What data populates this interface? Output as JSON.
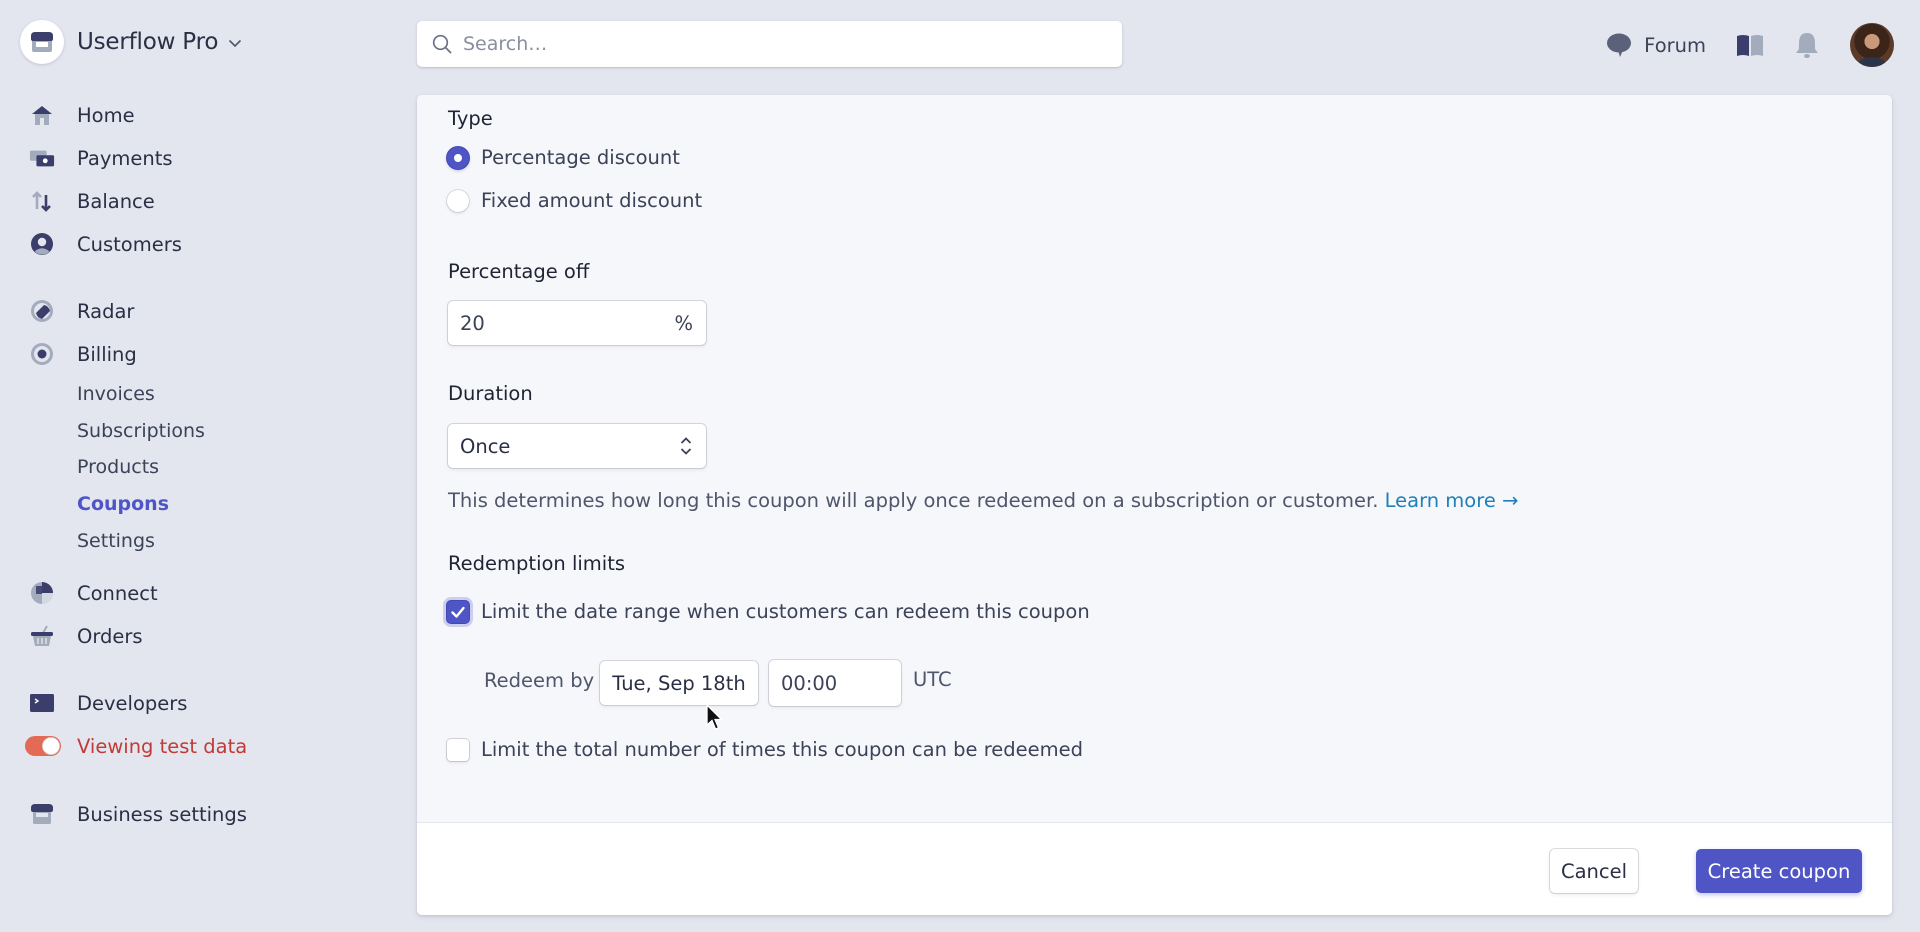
{
  "brand": {
    "name": "Userflow Pro"
  },
  "sidebar": {
    "items": [
      {
        "label": "Home",
        "icon": "home-icon"
      },
      {
        "label": "Payments",
        "icon": "payments-icon"
      },
      {
        "label": "Balance",
        "icon": "balance-icon"
      },
      {
        "label": "Customers",
        "icon": "customers-icon"
      },
      {
        "label": "Radar",
        "icon": "radar-icon"
      },
      {
        "label": "Billing",
        "icon": "billing-icon"
      },
      {
        "label": "Connect",
        "icon": "connect-icon"
      },
      {
        "label": "Orders",
        "icon": "orders-icon"
      },
      {
        "label": "Developers",
        "icon": "developers-icon"
      },
      {
        "label": "Viewing test data",
        "icon": "toggle-icon",
        "toggle_on": true
      },
      {
        "label": "Business settings",
        "icon": "business-settings-icon"
      }
    ],
    "billing_subitems": [
      {
        "label": "Invoices",
        "active": false
      },
      {
        "label": "Subscriptions",
        "active": false
      },
      {
        "label": "Products",
        "active": false
      },
      {
        "label": "Coupons",
        "active": true
      },
      {
        "label": "Settings",
        "active": false
      }
    ]
  },
  "search": {
    "placeholder": "Search…",
    "value": ""
  },
  "topbar": {
    "forum_label": "Forum"
  },
  "form": {
    "type_label": "Type",
    "type_options": [
      {
        "label": "Percentage discount",
        "selected": true
      },
      {
        "label": "Fixed amount discount",
        "selected": false
      }
    ],
    "percentage_label": "Percentage off",
    "percentage_value": "20",
    "percentage_suffix": "%",
    "duration_label": "Duration",
    "duration_value": "Once",
    "duration_help": "This determines how long this coupon will apply once redeemed on a subscription or customer.",
    "learn_more": "Learn more →",
    "redemption_label": "Redemption limits",
    "limit_date": {
      "label": "Limit the date range when customers can redeem this coupon",
      "checked": true
    },
    "redeem_by_label": "Redeem by",
    "redeem_date": "Tue, Sep 18th",
    "redeem_time": "00:00",
    "timezone": "UTC",
    "limit_count": {
      "label": "Limit the total number of times this coupon can be redeemed",
      "checked": false
    }
  },
  "footer": {
    "cancel_label": "Cancel",
    "create_label": "Create coupon"
  },
  "colors": {
    "accent": "#5055c6",
    "test_mode": "#c23a36",
    "link": "#1f7fb8"
  }
}
